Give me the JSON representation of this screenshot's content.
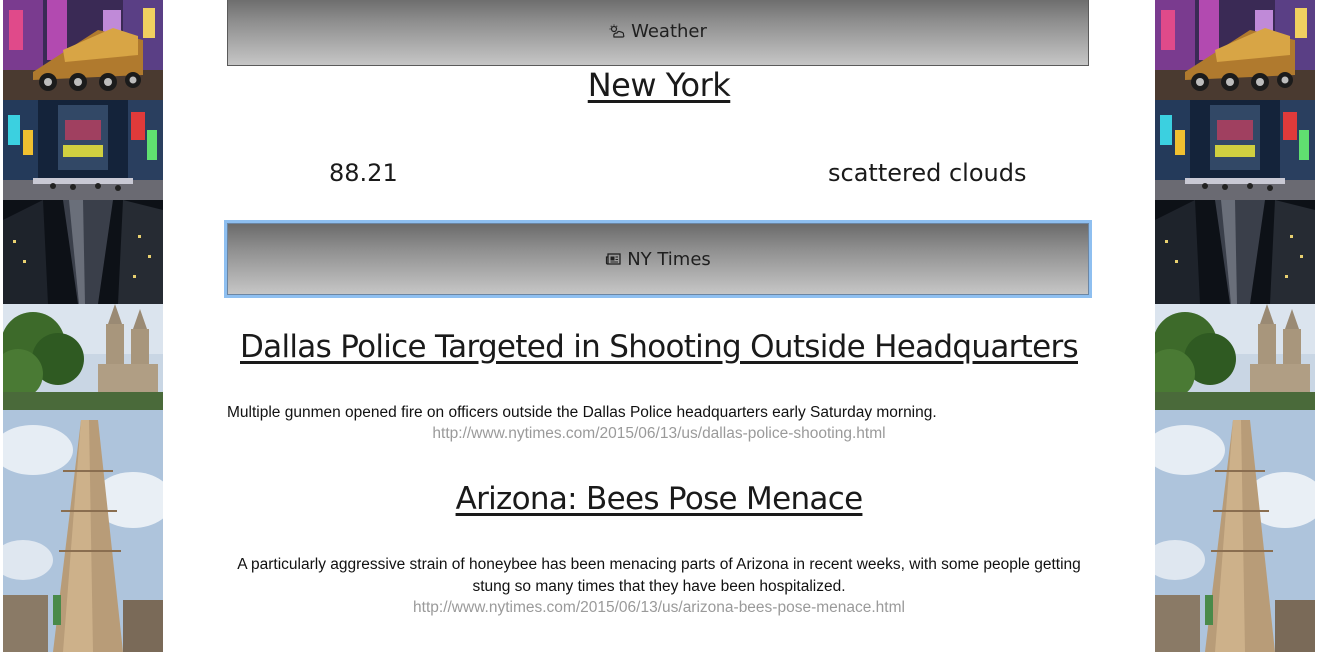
{
  "weather": {
    "button_label": "Weather",
    "icon": "partly-cloudy-icon",
    "city": "New York",
    "temperature": "88.21",
    "description": "scattered clouds"
  },
  "news": {
    "button_label": "NY Times",
    "icon": "newspaper-icon",
    "articles": [
      {
        "title": "Dallas Police Targeted in Shooting Outside Headquarters",
        "summary": "Multiple gunmen opened fire on officers outside the Dallas Police headquarters early Saturday morning.",
        "url": "http://www.nytimes.com/2015/06/13/us/dallas-police-shooting.html"
      },
      {
        "title": "Arizona: Bees Pose Menace",
        "summary": "A particularly aggressive strain of honeybee has been menacing parts of Arizona in recent weeks, with some people getting stung so many times that they have been hospitalized.",
        "url": "http://www.nytimes.com/2015/06/13/us/arizona-bees-pose-menace.html"
      }
    ]
  },
  "side_images": [
    "truck-times-square-photo",
    "times-square-night-photo",
    "skyscraper-night-photo",
    "central-park-towers-photo",
    "flatiron-building-photo"
  ]
}
